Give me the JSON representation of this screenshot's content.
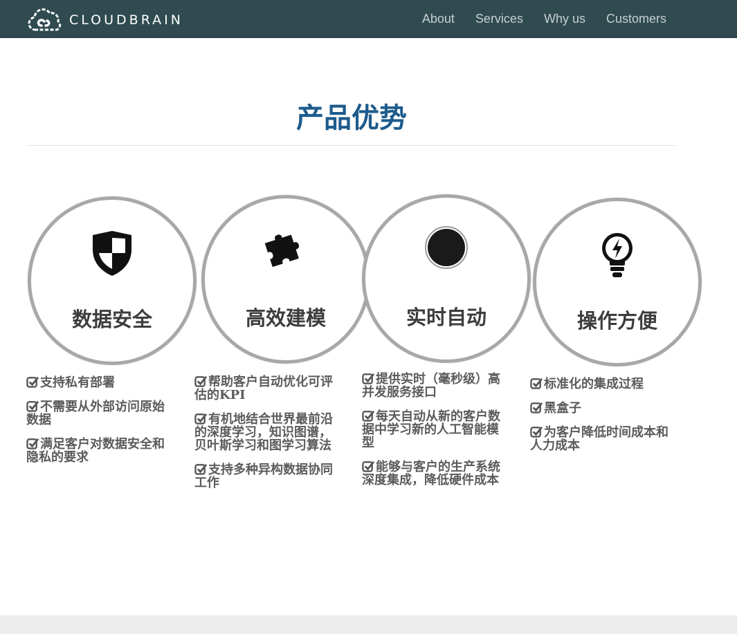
{
  "brand": {
    "name": "CLOUDBRAIN"
  },
  "nav": [
    "About",
    "Services",
    "Why us",
    "Customers"
  ],
  "section": {
    "title": "产品优势"
  },
  "features": [
    {
      "title": "数据安全",
      "icon": "shield-icon",
      "bullets": [
        "支持私有部署",
        "不需要从外部访问原始数据",
        "满足客户对数据安全和隐私的要求"
      ]
    },
    {
      "title": "高效建模",
      "icon": "puzzle-icon",
      "bullets": [
        "帮助客户自动优化可评估的KPI",
        "有机地结合世界最前沿的深度学习，知识图谱，贝叶斯学习和图学习算法",
        "支持多种异构数据协同工作"
      ]
    },
    {
      "title": "实时自动",
      "icon": "record-icon",
      "bullets": [
        "提供实时（毫秒级）高并发服务接口",
        "每天自动从新的客户数据中学习新的人工智能模型",
        "能够与客户的生产系统深度集成，降低硬件成本"
      ]
    },
    {
      "title": "操作方便",
      "icon": "lightbulb-icon",
      "bullets": [
        "标准化的集成过程",
        "黑盒子",
        "为客户降低时间成本和人力成本"
      ]
    }
  ],
  "colors": {
    "navbar": "#2f4b4f",
    "title": "#1e5b8c",
    "circle_border": "#a8a8a8",
    "text": "#5b5b5b"
  }
}
